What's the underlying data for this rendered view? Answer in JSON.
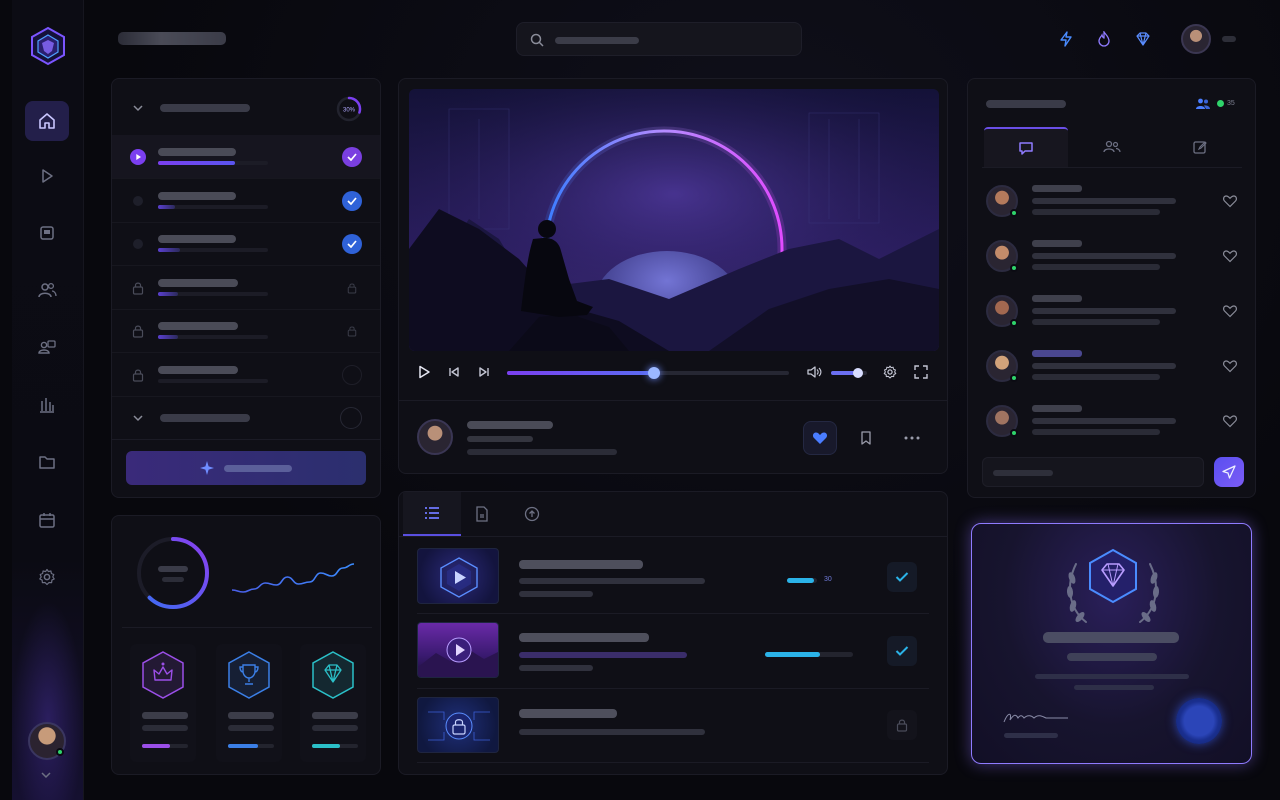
{
  "colors": {
    "accent_purple": "#7b3ff0",
    "accent_blue": "#3b6ef2",
    "accent_cyan": "#2bb3e8",
    "online_green": "#2fd36b",
    "background": "#08080d",
    "panel": "#0f0f16"
  },
  "sidebar": {
    "logo": "shield-logo",
    "items": [
      {
        "icon": "home-icon",
        "active": true
      },
      {
        "icon": "play-icon",
        "active": false
      },
      {
        "icon": "notes-icon",
        "active": false
      },
      {
        "icon": "users-icon",
        "active": false
      },
      {
        "icon": "team-icon",
        "active": false
      },
      {
        "icon": "bar-chart-icon",
        "active": false
      },
      {
        "icon": "folder-icon",
        "active": false
      },
      {
        "icon": "calendar-icon",
        "active": false
      },
      {
        "icon": "gear-icon",
        "active": false
      }
    ],
    "user": {
      "status": "online"
    }
  },
  "header": {
    "search_placeholder": "",
    "icons": [
      "lightning-icon",
      "flame-icon",
      "diamond-icon"
    ]
  },
  "course": {
    "progress_percent": "30%",
    "lessons": [
      {
        "state": "playing",
        "progress": 0.7,
        "status": "done"
      },
      {
        "state": "idle",
        "progress": 0.15,
        "status": "done"
      },
      {
        "state": "idle",
        "progress": 0.2,
        "status": "done"
      },
      {
        "state": "locked",
        "progress": 0.18,
        "status": "locked"
      },
      {
        "state": "locked",
        "progress": 0.18,
        "status": "locked"
      },
      {
        "state": "locked",
        "progress": 0.0,
        "status": "empty"
      }
    ]
  },
  "player": {
    "progress": 0.52,
    "volume": 0.75,
    "liked": true
  },
  "modules": {
    "tabs": [
      "list-icon",
      "document-icon",
      "upload-icon"
    ],
    "items": [
      {
        "thumb": "cube-play",
        "progress": 0.9,
        "progress_label": "30",
        "status": "done"
      },
      {
        "thumb": "landscape-play",
        "progress": 0.62,
        "progress_label": "",
        "status": "done"
      },
      {
        "thumb": "locked-circuit",
        "progress": 0.0,
        "progress_label": "",
        "status": "locked"
      }
    ]
  },
  "chat": {
    "online_count": "35",
    "tabs": [
      "chat-bubble-icon",
      "users-icon",
      "edit-icon"
    ],
    "messages": [
      {
        "avatar": "#b47a5c"
      },
      {
        "avatar": "#c38b6a"
      },
      {
        "avatar": "#a26850"
      },
      {
        "avatar": "#d2a27a"
      },
      {
        "avatar": "#a07461"
      }
    ],
    "input_placeholder": ""
  },
  "stats": {
    "ring_progress": 0.62,
    "trend": [
      34,
      36,
      33,
      27,
      29,
      21,
      28,
      26,
      17,
      20,
      12,
      8
    ],
    "badges": [
      {
        "icon": "crown-icon",
        "color": "#9b4fe8",
        "progress": 0.6
      },
      {
        "icon": "trophy-icon",
        "color": "#3b7fe6",
        "progress": 0.65
      },
      {
        "icon": "diamond-badge-icon",
        "color": "#2bc0c8",
        "progress": 0.6
      }
    ]
  },
  "certificate": {
    "icon": "laurel-diamond-icon",
    "signature": "signature-mark"
  }
}
